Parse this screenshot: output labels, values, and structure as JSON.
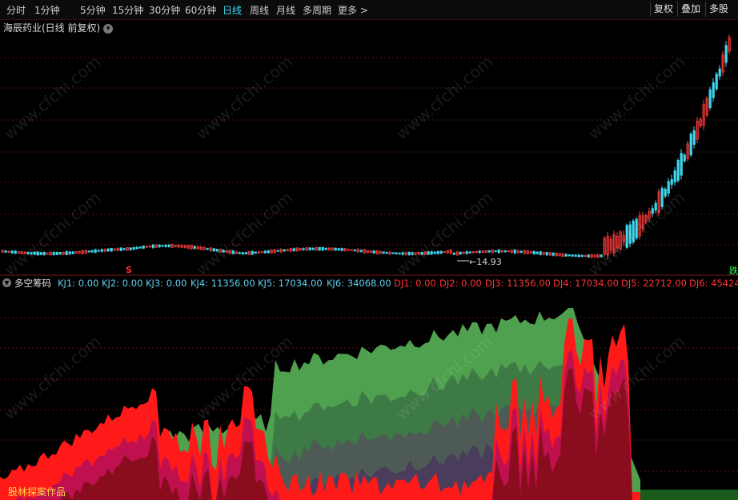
{
  "toolbar": {
    "periods": [
      {
        "label": "分时",
        "active": false
      },
      {
        "label": "1分钟",
        "active": false
      },
      {
        "label": "5分钟",
        "active": false
      },
      {
        "label": "15分钟",
        "active": false
      },
      {
        "label": "30分钟",
        "active": false
      },
      {
        "label": "60分钟",
        "active": false
      },
      {
        "label": "日线",
        "active": true
      },
      {
        "label": "周线",
        "active": false
      },
      {
        "label": "月线",
        "active": false
      },
      {
        "label": "多周期",
        "active": false
      },
      {
        "label": "更多 >",
        "active": false
      }
    ],
    "right_buttons": [
      "复权",
      "叠加",
      "多股"
    ]
  },
  "chart": {
    "title": "海辰药业(日线 前复权)",
    "low_price_label": "←14.93",
    "signal_mark": "S",
    "side_mark": "跌"
  },
  "indicator": {
    "name": "多空筹码",
    "kj": [
      "KJ1: 0.00",
      "KJ2: 0.00",
      "KJ3: 0.00",
      "KJ4: 11356.00",
      "KJ5: 17034.00",
      "KJ6: 34068.00"
    ],
    "dj": [
      "DJ1: 0.00",
      "DJ2: 0.00",
      "DJ3: 11356.00",
      "DJ4: 17034.00",
      "DJ5: 22712.00",
      "DJ6: 45424"
    ]
  },
  "credit": "股林探案作品",
  "watermark": "www.cfchi.com",
  "colors": {
    "up": "#ff3b3b",
    "down": "#3fd7ee",
    "green_area": "#4fa04f",
    "red_area": "#ff1a1a",
    "grid": "#5a0f0f",
    "accent": "#3bd6f0"
  }
}
